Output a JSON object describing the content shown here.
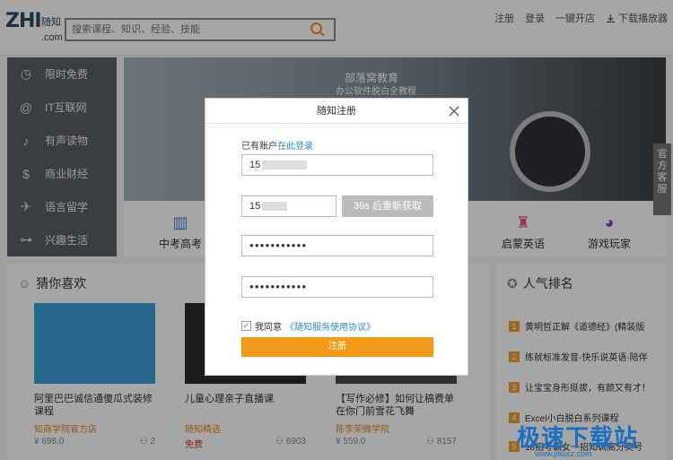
{
  "header": {
    "logo_mark": "ZHI",
    "logo_brand": "随知",
    "logo_domain": ".com",
    "search_placeholder": "搜索课程、知识、经验、技能",
    "links": [
      "注册",
      "登录",
      "一键开店",
      "下载播放器"
    ]
  },
  "sidebar": {
    "items": [
      {
        "label": "限时免费",
        "icon": "clock-icon"
      },
      {
        "label": "IT互联网",
        "icon": "at-icon"
      },
      {
        "label": "有声读物",
        "icon": "music-icon"
      },
      {
        "label": "商业财经",
        "icon": "money-icon"
      },
      {
        "label": "语言留学",
        "icon": "plane-icon"
      },
      {
        "label": "兴趣生活",
        "icon": "dumbbell-icon"
      }
    ]
  },
  "banner": {
    "title": "部落窝教育",
    "subtitle": "办公软件脱白全教程"
  },
  "categories": [
    {
      "label": "中考高考",
      "icon": "book-icon"
    },
    {
      "label": "启蒙英语",
      "icon": "stroller-icon"
    },
    {
      "label": "游戏玩家",
      "icon": "pacman-icon"
    }
  ],
  "guess": {
    "title": "猜你喜欢",
    "cards": [
      {
        "title": "阿里巴巴诚信通傻瓜式装修课程",
        "org": "知商学院官方店",
        "price": "¥ 698.0",
        "learners": "2",
        "thumb_color": "#3aa0d8"
      },
      {
        "title": "儿童心理亲子直播课",
        "org": "随知精选",
        "price": "免费",
        "learners": "6903",
        "thumb_color": "#2b2b2b"
      },
      {
        "title": "【写作必修】如何让稿费单在你门前雪花飞舞",
        "org": "陈李荣微学院",
        "price": "¥ 559.0",
        "learners": "8157",
        "thumb_color": "#4a4a4a"
      }
    ]
  },
  "rank": {
    "title": "人气排名",
    "items": [
      {
        "num": "1",
        "text": "黄明哲正解《道德经》(精装版"
      },
      {
        "num": "2",
        "text": "练就标准发音-快乐说英语-陪伴"
      },
      {
        "num": "3",
        "text": "让宝宝身形挺拔，有颜又有才！"
      },
      {
        "num": "4",
        "text": "Excel小白脱白系列课程"
      },
      {
        "num": "5",
        "text": "18招考霸女一招知调高分奥号"
      }
    ]
  },
  "side_tab": "官方客服",
  "modal": {
    "title": "随知注册",
    "has_account": "已有账户",
    "login_link": "在此登录",
    "phone_prefix": "15",
    "code_prefix": "15",
    "sms_button": "39s 后重新获取",
    "password_mask": "●●●●●●●●●●●",
    "confirm_mask": "●●●●●●●●●●●",
    "agree_text": "我同意",
    "agree_link": "《随知服务使用协议》",
    "submit": "注册"
  },
  "watermark": {
    "text": "极速下载站",
    "url": "www.jisuxz.com"
  },
  "colors": {
    "accent": "#f39a17",
    "link": "#2a8ad0",
    "sidebar_bg": "#5a5e66"
  }
}
